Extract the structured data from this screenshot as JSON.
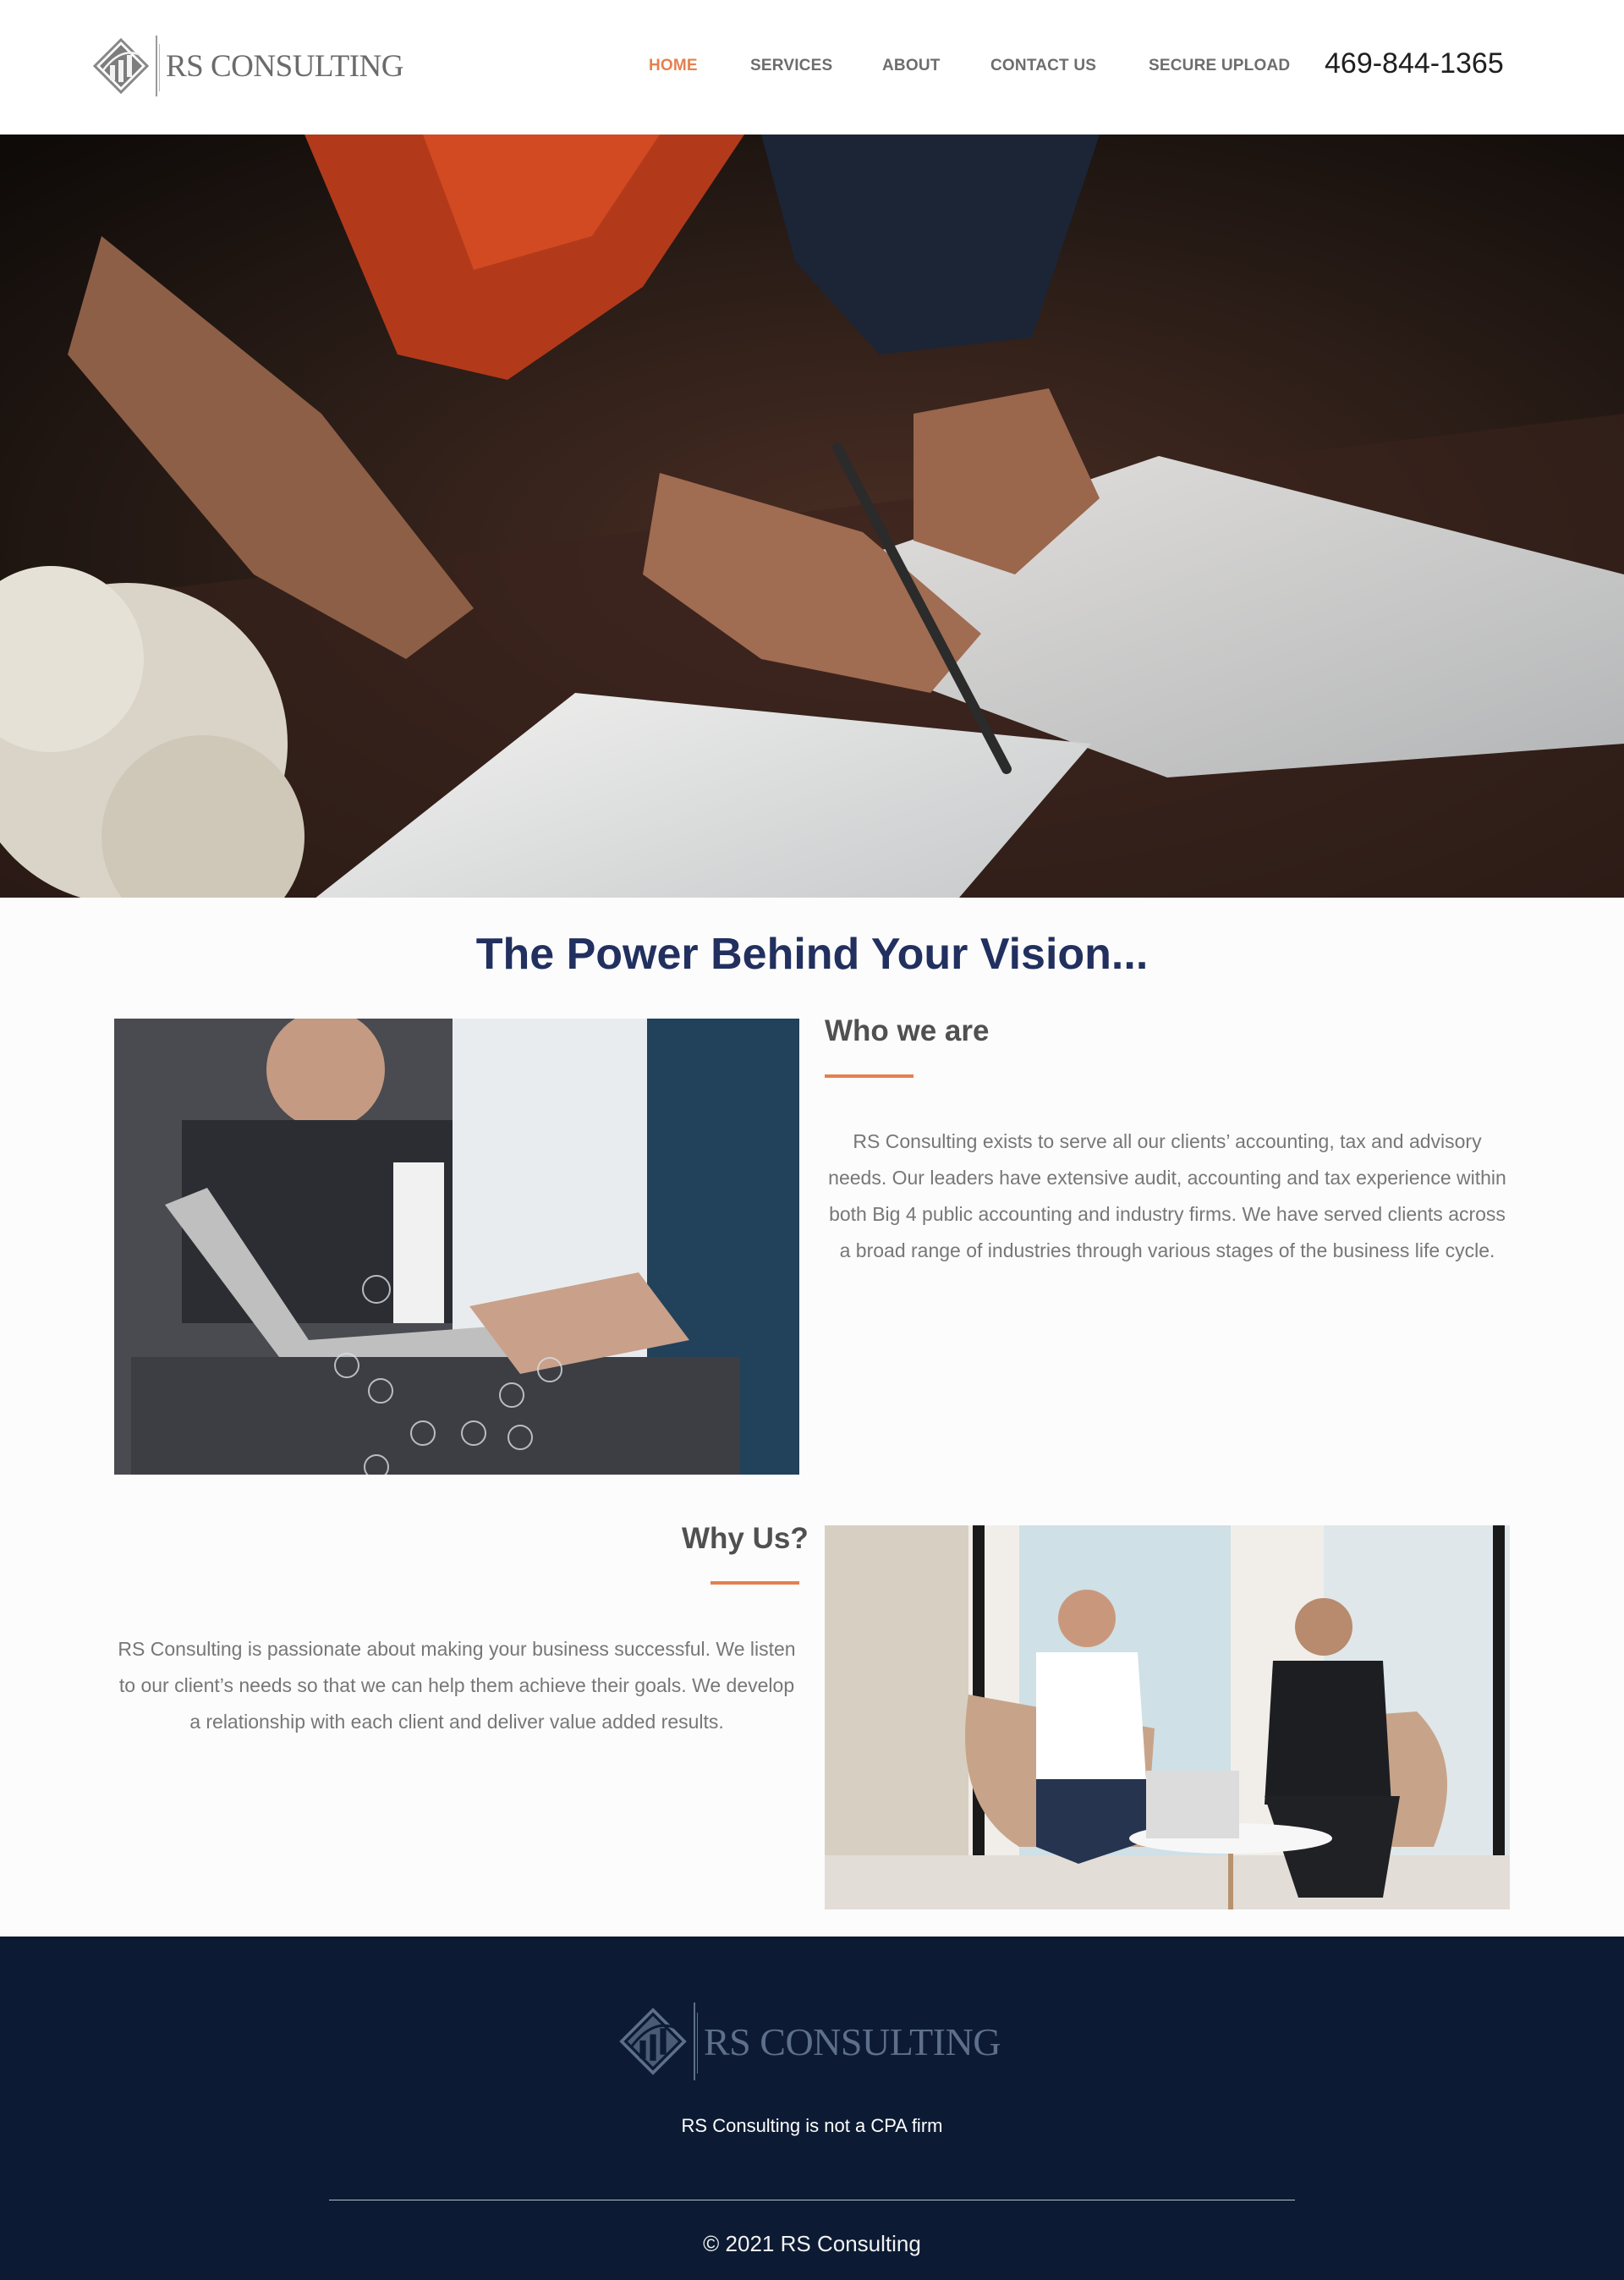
{
  "brand": {
    "name": "RS CONSULTING",
    "accent_color": "#e5804f",
    "navy_color": "#22305f",
    "footer_bg": "#0c1b33"
  },
  "nav": {
    "items": [
      {
        "label": "HOME",
        "active": true
      },
      {
        "label": "SERVICES",
        "active": false
      },
      {
        "label": "ABOUT",
        "active": false
      },
      {
        "label": "CONTACT US",
        "active": false
      },
      {
        "label": "SECURE UPLOAD",
        "active": false
      }
    ],
    "phone": "469-844-1365"
  },
  "hero": {
    "image": "photo-hands-signing-documents"
  },
  "main": {
    "tagline": "The Power Behind Your Vision...",
    "who": {
      "heading": "Who we are",
      "text": "RS Consulting exists to serve all our clients’ accounting, tax and advisory needs. Our leaders have extensive audit, accounting and tax experience within both Big 4 public accounting and industry firms. We have served clients across a broad range of industries through various stages of the business life cycle.",
      "image": "photo-business-meeting-laptop"
    },
    "why": {
      "heading": "Why Us?",
      "text": "RS Consulting is passionate about making your business successful. We listen to our client’s needs so that we can help them achieve their goals. We develop a relationship with each client and deliver value added results.",
      "image": "photo-two-businessmen-talking"
    }
  },
  "footer": {
    "logo_text": "RS CONSULTING",
    "note": "RS Consulting is not a CPA firm",
    "copyright": "© 2021 RS Consulting"
  }
}
